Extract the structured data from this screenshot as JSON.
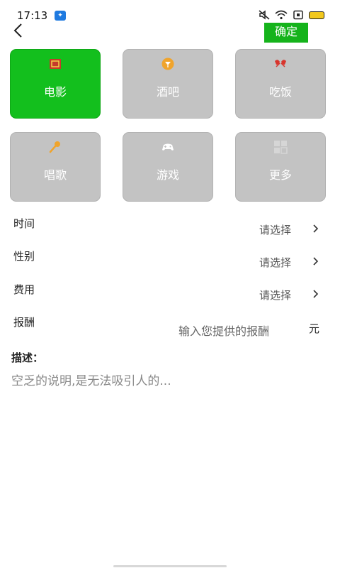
{
  "status_bar": {
    "time": "17:13",
    "app_icon": "app-notification-icon",
    "icons": [
      "mute-icon",
      "wifi-icon",
      "sim-icon",
      "battery-icon"
    ]
  },
  "header": {
    "back_icon": "back-arrow-icon",
    "confirm_label": "确定",
    "confirm_color": "#15b31b"
  },
  "categories": [
    {
      "label": "电影",
      "icon": "movie-icon",
      "selected": true
    },
    {
      "label": "酒吧",
      "icon": "bar-icon",
      "selected": false
    },
    {
      "label": "吃饭",
      "icon": "dining-icon",
      "selected": false
    },
    {
      "label": "唱歌",
      "icon": "microphone-icon",
      "selected": false
    },
    {
      "label": "游戏",
      "icon": "gamepad-icon",
      "selected": false
    },
    {
      "label": "更多",
      "icon": "more-grid-icon",
      "selected": false
    }
  ],
  "colors": {
    "selected_tile": "#13bf1d",
    "default_tile": "#c3c3c3"
  },
  "form": {
    "time": {
      "label": "时间",
      "value": "请选择"
    },
    "gender": {
      "label": "性别",
      "value": "请选择"
    },
    "fee": {
      "label": "费用",
      "value": "请选择"
    },
    "reward": {
      "label": "报酬",
      "placeholder": "输入您提供的报酬",
      "unit": "元"
    }
  },
  "description": {
    "title": "描述：",
    "placeholder": "空乏的说明,是无法吸引人的..."
  }
}
